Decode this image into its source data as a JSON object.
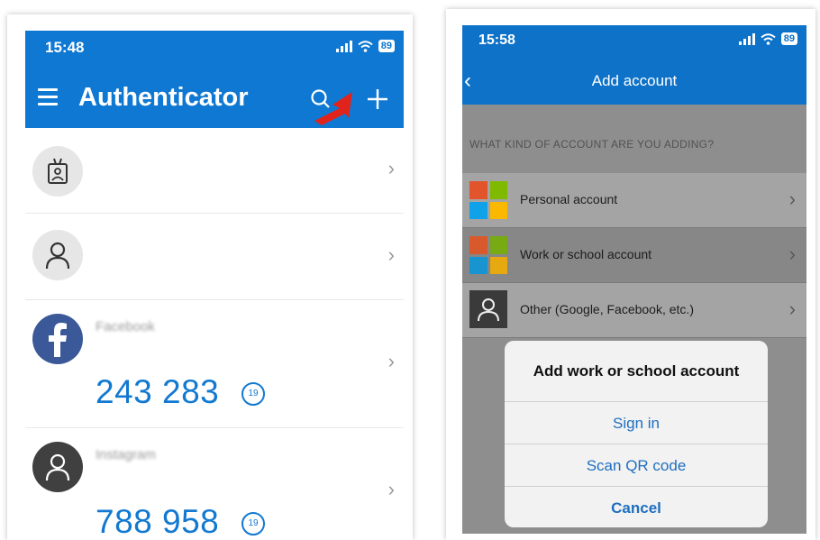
{
  "phone1": {
    "status": {
      "time": "15:48",
      "battery": "89"
    },
    "header": {
      "title": "Authenticator",
      "menu_icon": "hamburger-menu-icon",
      "search_icon": "search-icon",
      "add_icon": "plus-icon"
    },
    "accounts": [
      {
        "icon": "id-badge-icon",
        "name": "",
        "code": ""
      },
      {
        "icon": "person-icon",
        "name": "",
        "code": ""
      },
      {
        "icon": "facebook-icon",
        "name": "Facebook",
        "code": "243 283",
        "timer": "19"
      },
      {
        "icon": "person-icon",
        "name": "Instagram",
        "code": "788 958",
        "timer": "19"
      }
    ],
    "accent_color": "#0e78d2"
  },
  "phone2": {
    "status": {
      "time": "15:58",
      "battery": "89"
    },
    "header": {
      "title": "Add account"
    },
    "section_label": "WHAT KIND OF ACCOUNT ARE YOU ADDING?",
    "options": [
      {
        "label": "Personal account",
        "icon": "microsoft-logo-icon"
      },
      {
        "label": "Work or school account",
        "icon": "microsoft-logo-icon",
        "selected": true
      },
      {
        "label": "Other (Google, Facebook, etc.)",
        "icon": "person-icon"
      }
    ],
    "sheet": {
      "title": "Add work or school account",
      "buttons": [
        "Sign in",
        "Scan QR code",
        "Cancel"
      ]
    }
  }
}
